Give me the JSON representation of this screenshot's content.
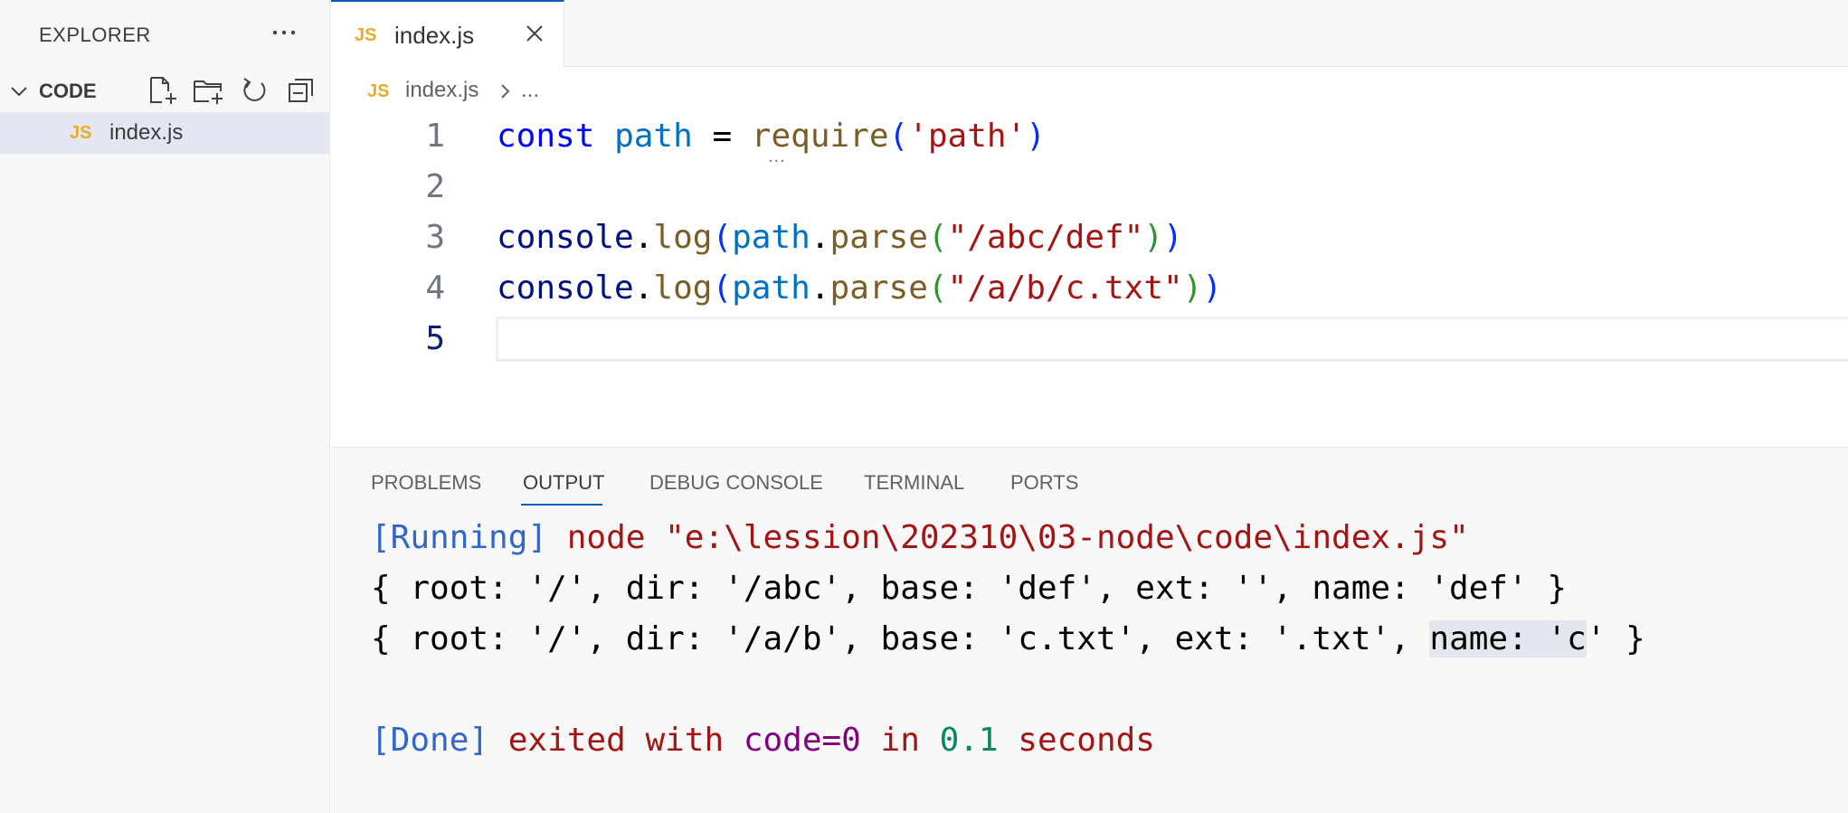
{
  "sidebar": {
    "title": "EXPLORER",
    "more_label": "···",
    "folder": {
      "name": "CODE"
    },
    "files": [
      {
        "badge": "JS",
        "name": "index.js"
      }
    ]
  },
  "tab": {
    "badge": "JS",
    "label": "index.js"
  },
  "breadcrumb": {
    "badge": "JS",
    "file": "index.js",
    "more": "..."
  },
  "editor": {
    "line_numbers": [
      "1",
      "2",
      "3",
      "4",
      "5"
    ],
    "active_line": "5",
    "lines": [
      "const path = require('path')",
      "",
      "console.log(path.parse(\"/abc/def\"))",
      "console.log(path.parse(\"/a/b/c.txt\"))",
      ""
    ],
    "hint": "..."
  },
  "panel": {
    "tabs": [
      "PROBLEMS",
      "OUTPUT",
      "DEBUG CONSOLE",
      "TERMINAL",
      "PORTS"
    ],
    "active_tab": "OUTPUT",
    "output": {
      "running_tag": "[Running]",
      "running_cmd": " node \"e:\\lession\\202310\\03-node\\code\\index.js\"",
      "result1": "{ root: '/', dir: '/abc', base: 'def', ext: '', name: 'def' }",
      "result2_pre": "{ root: '/', dir: '/a/b', base: 'c.txt', ext: '.txt', ",
      "result2_hl": "name: 'c",
      "result2_post": "' }",
      "done_tag": "[Done]",
      "done_text": " exited with ",
      "done_code": "code=0",
      "done_in": " in ",
      "done_secs": "0.1",
      "done_unit": " seconds"
    }
  },
  "colors": {
    "accent": "#005fb8",
    "js_badge": "#e8ab2a",
    "selected_row": "#e4e6f1"
  }
}
